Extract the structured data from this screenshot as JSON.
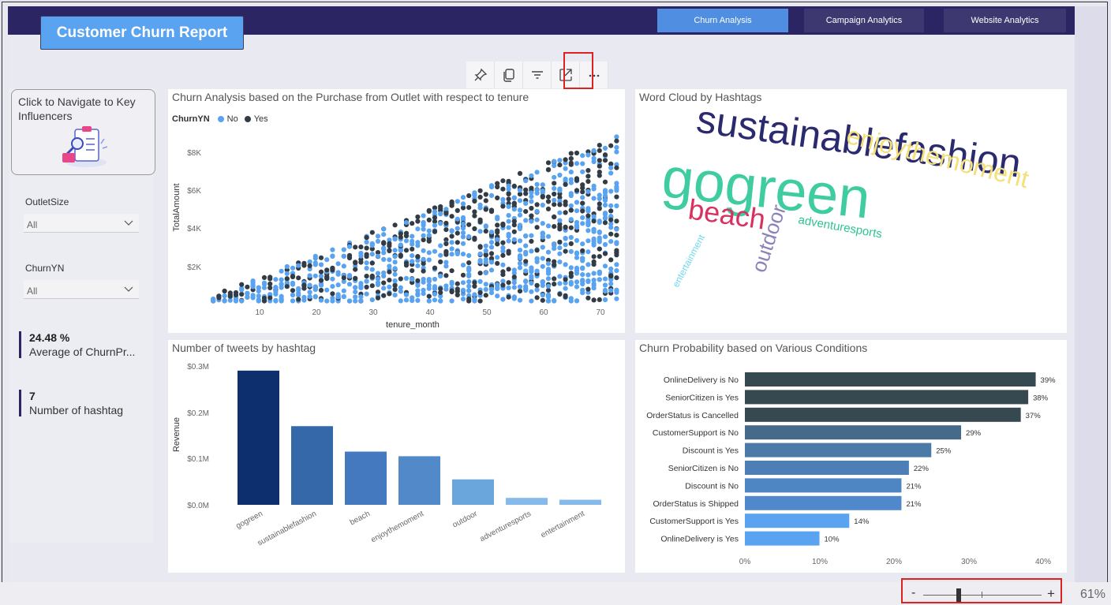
{
  "header": {
    "report_title": "Customer Churn Report",
    "tabs": [
      {
        "label": "Churn Analysis",
        "active": true
      },
      {
        "label": "Campaign Analytics",
        "active": false
      },
      {
        "label": "Website Analytics",
        "active": false
      }
    ]
  },
  "toolbar": {
    "icons": [
      "pin-icon",
      "copy-icon",
      "filter-icon",
      "focus-mode-icon",
      "more-options-icon"
    ]
  },
  "left_panel": {
    "key_influencers_label": "Click to Navigate to Key Influencers",
    "filters": [
      {
        "label": "OutletSize",
        "value": "All"
      },
      {
        "label": "ChurnYN",
        "value": "All"
      }
    ],
    "kpis": [
      {
        "value": "24.48 %",
        "label": "Average of ChurnPr..."
      },
      {
        "value": "7",
        "label": "Number of hashtag"
      }
    ]
  },
  "scatter": {
    "title": "Churn Analysis based on the Purchase from Outlet with respect to tenure",
    "legend_title": "ChurnYN",
    "legend": [
      {
        "name": "No",
        "color": "#5aa3f0"
      },
      {
        "name": "Yes",
        "color": "#333c44"
      }
    ],
    "xlabel": "tenure_month",
    "ylabel": "TotalAmount",
    "xticks": [
      "10",
      "20",
      "30",
      "40",
      "50",
      "60",
      "70"
    ],
    "yticks": [
      "$2K",
      "$4K",
      "$6K",
      "$8K"
    ]
  },
  "wordcloud": {
    "title": "Word Cloud by Hashtags",
    "words": [
      {
        "text": "gogreen",
        "color": "#3fcca0"
      },
      {
        "text": "sustainablefashion",
        "color": "#2b2a6e"
      },
      {
        "text": "enjoythemoment",
        "color": "#f4e07a"
      },
      {
        "text": "beach",
        "color": "#d9305f"
      },
      {
        "text": "outdoor",
        "color": "#8a84b8"
      },
      {
        "text": "adventuresports",
        "color": "#2fc490"
      },
      {
        "text": "entertainment",
        "color": "#6fd8f0"
      }
    ]
  },
  "chart_data": [
    {
      "type": "bar",
      "title": "Number of tweets by hashtag",
      "ylabel": "Revenue",
      "categories": [
        "gogreen",
        "sustainablefashion",
        "beach",
        "enjoythemoment",
        "outdoor",
        "adventuresports",
        "entertainment"
      ],
      "values": [
        0.29,
        0.17,
        0.115,
        0.105,
        0.055,
        0.015,
        0.011
      ],
      "yticks": [
        "$0.0M",
        "$0.1M",
        "$0.2M",
        "$0.3M"
      ],
      "ylim": [
        0,
        0.3
      ],
      "colors": [
        "#0e2f6e",
        "#3568a8",
        "#4479bf",
        "#5289c9",
        "#6aa5dc",
        "#85baea",
        "#85baea"
      ]
    },
    {
      "type": "bar",
      "orientation": "horizontal",
      "title": "Churn Probability based on Various Conditions",
      "categories": [
        "OnlineDelivery is No",
        "SeniorCitizen is Yes",
        "OrderStatus is Cancelled",
        "CustomerSupport is No",
        "Discount is Yes",
        "SeniorCitizen is No",
        "Discount is No",
        "OrderStatus is Shipped",
        "CustomerSupport is Yes",
        "OnlineDelivery is Yes"
      ],
      "values": [
        39,
        38,
        37,
        29,
        25,
        22,
        21,
        21,
        14,
        10
      ],
      "labels": [
        "39%",
        "38%",
        "37%",
        "29%",
        "25%",
        "22%",
        "21%",
        "21%",
        "14%",
        "10%"
      ],
      "xticks": [
        "0%",
        "10%",
        "20%",
        "30%",
        "40%"
      ],
      "xlim": [
        0,
        40
      ],
      "colors": [
        "#364850",
        "#364850",
        "#364850",
        "#476a8a",
        "#4b79a8",
        "#4d7fb6",
        "#4e86c4",
        "#5089cb",
        "#5aa3f0",
        "#5aa3f0"
      ]
    }
  ],
  "zoom": {
    "minus": "-",
    "plus": "+",
    "level": "61%",
    "slider_fraction": 0.3
  }
}
